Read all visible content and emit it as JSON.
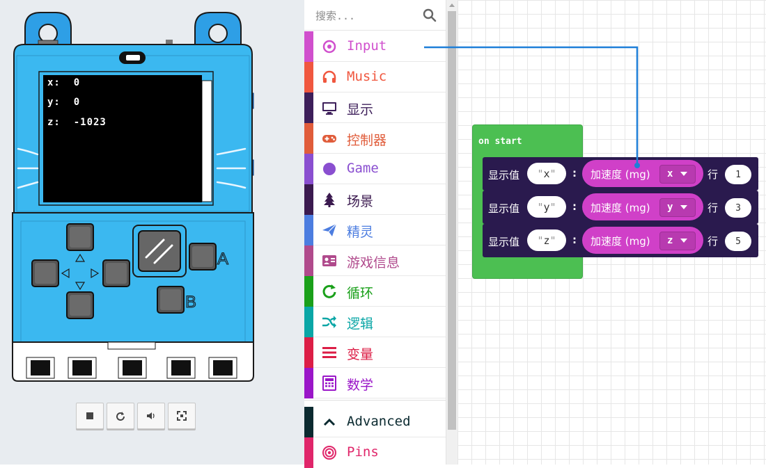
{
  "simulator": {
    "screen_lines": [
      "x:  0",
      "y:  0",
      "z:  -1023"
    ],
    "button_a_label": "A",
    "button_b_label": "B",
    "controls": [
      {
        "name": "stop-icon"
      },
      {
        "name": "restart-icon"
      },
      {
        "name": "volume-icon"
      },
      {
        "name": "fullscreen-icon"
      }
    ]
  },
  "toolbox": {
    "search_placeholder": "搜索...",
    "categories": [
      {
        "label": "Input",
        "color": "#d04fcd",
        "icon": "input-icon"
      },
      {
        "label": "Music",
        "color": "#f0573f",
        "icon": "headphones-icon"
      },
      {
        "label": "显示",
        "color": "#3d1f5a",
        "icon": "monitor-icon"
      },
      {
        "label": "控制器",
        "color": "#e05c3a",
        "icon": "gamepad-icon"
      },
      {
        "label": "Game",
        "color": "#8a4fd0",
        "icon": "circle-icon"
      },
      {
        "label": "场景",
        "color": "#3b1a4f",
        "icon": "tree-icon"
      },
      {
        "label": "精灵",
        "color": "#4c7de0",
        "icon": "paper-plane-icon"
      },
      {
        "label": "游戏信息",
        "color": "#b04a8c",
        "icon": "id-card-icon"
      },
      {
        "label": "循环",
        "color": "#1aa01a",
        "icon": "refresh-icon"
      },
      {
        "label": "逻辑",
        "color": "#0aa6a6",
        "icon": "shuffle-icon"
      },
      {
        "label": "变量",
        "color": "#dc1e46",
        "icon": "list-icon"
      },
      {
        "label": "数学",
        "color": "#9a16c8",
        "icon": "calculator-icon"
      },
      {
        "label": "Advanced",
        "color": "#0b2a30",
        "icon": "chevron-up-icon"
      },
      {
        "label": "Pins",
        "color": "#e0266a",
        "icon": "target-icon"
      }
    ]
  },
  "workspace": {
    "start_block_label": "on start",
    "rows": [
      {
        "show_label": "显示值",
        "name": "x",
        "reading": "加速度 (mg)",
        "axis": "x",
        "line_label": "行",
        "line": "1"
      },
      {
        "show_label": "显示值",
        "name": "y",
        "reading": "加速度 (mg)",
        "axis": "y",
        "line_label": "行",
        "line": "3"
      },
      {
        "show_label": "显示值",
        "name": "z",
        "reading": "加速度 (mg)",
        "axis": "z",
        "line_label": "行",
        "line": "5"
      }
    ]
  }
}
